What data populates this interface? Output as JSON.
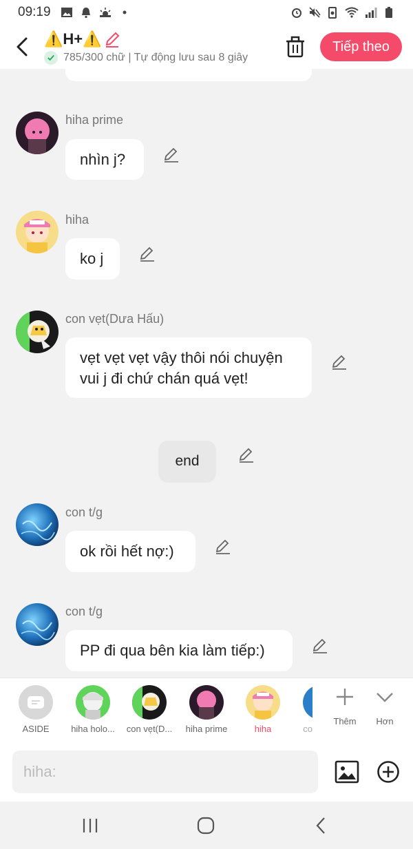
{
  "status": {
    "time": "09:19"
  },
  "header": {
    "title": "⚠️H+⚠️",
    "subtitle": "785/300 chữ | Tự động lưu sau 8 giây",
    "next_label": "Tiếp theo"
  },
  "messages": [
    {
      "name": "hiha prime",
      "text": "nhìn j?"
    },
    {
      "name": "hiha",
      "text": "ko j"
    },
    {
      "name": "con vẹt(Dưa Hấu)",
      "text": "vẹt vẹt vẹt vậy thôi nói chuyện vui j đi chứ chán quá vẹt!"
    },
    {
      "name": "",
      "text": "end"
    },
    {
      "name": "con t/g",
      "text": "ok rồi hết nợ:)"
    },
    {
      "name": "con t/g",
      "text": "PP đi qua bên kia làm tiếp:)"
    }
  ],
  "roles": [
    {
      "label": "ASIDE"
    },
    {
      "label": "hiha holo..."
    },
    {
      "label": "con vẹt(D..."
    },
    {
      "label": "hiha prime"
    },
    {
      "label": "hiha"
    },
    {
      "label": "co"
    }
  ],
  "actions": {
    "more_label": "Thêm",
    "less_label": "Hơn"
  },
  "input": {
    "placeholder": "hiha:"
  },
  "colors": {
    "accent": "#f54b6b",
    "background": "#f2f2f2"
  }
}
